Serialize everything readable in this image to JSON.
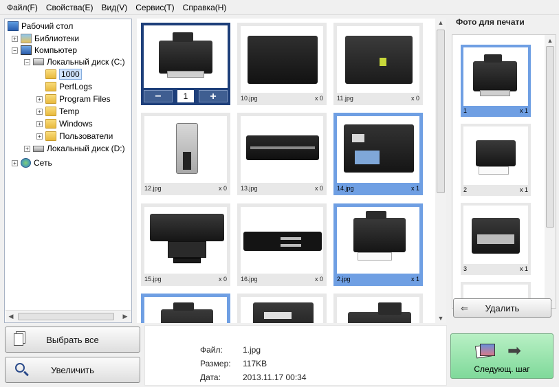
{
  "menu": [
    {
      "label": "Файл(F)"
    },
    {
      "label": "Свойства(E)"
    },
    {
      "label": "Вид(V)"
    },
    {
      "label": "Сервис(T)"
    },
    {
      "label": "Справка(H)"
    }
  ],
  "tree": {
    "desktop": "Рабочий стол",
    "libraries": "Библиотеки",
    "computer": "Компьютер",
    "drive_c": "Локальный диск (C:)",
    "folder_1000": "1000",
    "perflogs": "PerfLogs",
    "program_files": "Program Files",
    "temp": "Temp",
    "windows": "Windows",
    "users": "Пользователи",
    "drive_d": "Локальный диск (D:)",
    "network": "Сеть",
    "expand_plus": "+",
    "expand_minus": "−"
  },
  "grid": {
    "active_qty": "1",
    "minus": "−",
    "plus": "+",
    "tiles": [
      {
        "name": "10.jpg",
        "count": "x 0"
      },
      {
        "name": "11.jpg",
        "count": "x 0"
      },
      {
        "name": "12.jpg",
        "count": "x 0"
      },
      {
        "name": "13.jpg",
        "count": "x 0"
      },
      {
        "name": "14.jpg",
        "count": "x 1"
      },
      {
        "name": "15.jpg",
        "count": "x 0"
      },
      {
        "name": "16.jpg",
        "count": "x 0"
      },
      {
        "name": "2.jpg",
        "count": "x 1"
      }
    ]
  },
  "print_panel": {
    "title": "Фото для печати",
    "items": [
      {
        "name": "1",
        "count": "x 1"
      },
      {
        "name": "2",
        "count": "x 1"
      },
      {
        "name": "3",
        "count": "x 1"
      }
    ],
    "delete_label": "Удалить"
  },
  "bottom": {
    "select_all_label": "Выбрать все",
    "zoom_label": "Увеличить",
    "file_label": "Файл:",
    "file_value": "1.jpg",
    "size_label": "Размер:",
    "size_value": "117KB",
    "date_label": "Дата:",
    "date_value": "2013.11.17 00:34",
    "next_label": "Следующ. шаг"
  },
  "colors": {
    "selection": "#6f9fe3",
    "active": "#1e3f7a",
    "next_button": "#7fd99a"
  }
}
